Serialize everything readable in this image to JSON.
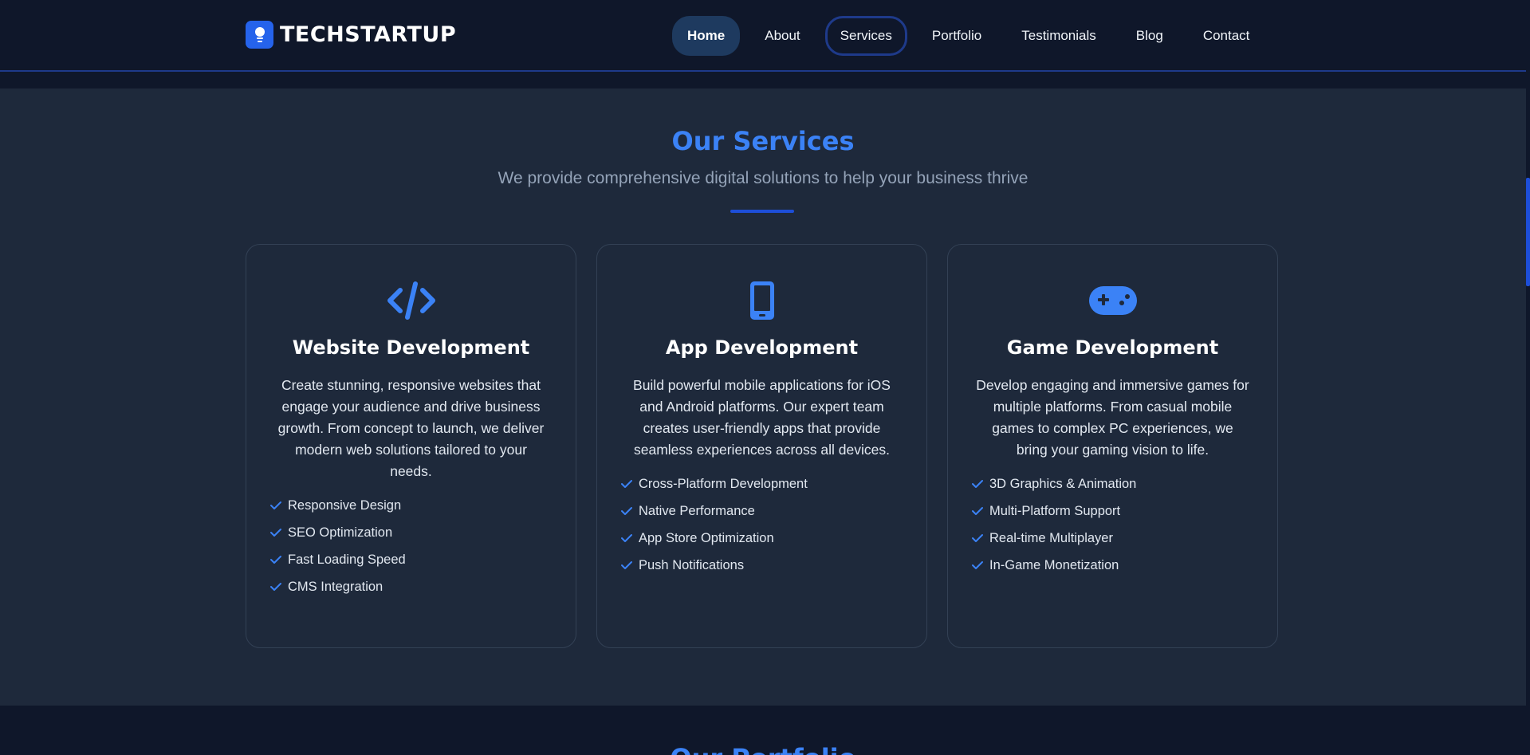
{
  "brand": {
    "name": "TECHSTARTUP",
    "accent": "#2563eb"
  },
  "nav": {
    "items": [
      {
        "label": "Home",
        "state": "active"
      },
      {
        "label": "About",
        "state": "normal"
      },
      {
        "label": "Services",
        "state": "focused"
      },
      {
        "label": "Portfolio",
        "state": "normal"
      },
      {
        "label": "Testimonials",
        "state": "normal"
      },
      {
        "label": "Blog",
        "state": "normal"
      },
      {
        "label": "Contact",
        "state": "normal"
      }
    ]
  },
  "services": {
    "title": "Our Services",
    "subtitle": "We provide comprehensive digital solutions to help your business thrive",
    "cards": [
      {
        "icon": "code-icon",
        "title": "Website Development",
        "description": "Create stunning, responsive websites that engage your audience and drive business growth. From concept to launch, we deliver modern web solutions tailored to your needs.",
        "features": [
          "Responsive Design",
          "SEO Optimization",
          "Fast Loading Speed",
          "CMS Integration"
        ]
      },
      {
        "icon": "mobile-phone-icon",
        "title": "App Development",
        "description": "Build powerful mobile applications for iOS and Android platforms. Our expert team creates user-friendly apps that provide seamless experiences across all devices.",
        "features": [
          "Cross-Platform Development",
          "Native Performance",
          "App Store Optimization",
          "Push Notifications"
        ]
      },
      {
        "icon": "gamepad-icon",
        "title": "Game Development",
        "description": "Develop engaging and immersive games for multiple platforms. From casual mobile games to complex PC experiences, we bring your gaming vision to life.",
        "features": [
          "3D Graphics & Animation",
          "Multi-Platform Support",
          "Real-time Multiplayer",
          "In-Game Monetization"
        ]
      }
    ]
  },
  "portfolio": {
    "title": "Our Portfolio"
  },
  "colors": {
    "accent": "#3b82f6",
    "background": "#0f172a",
    "section_bg": "#1e293b"
  }
}
